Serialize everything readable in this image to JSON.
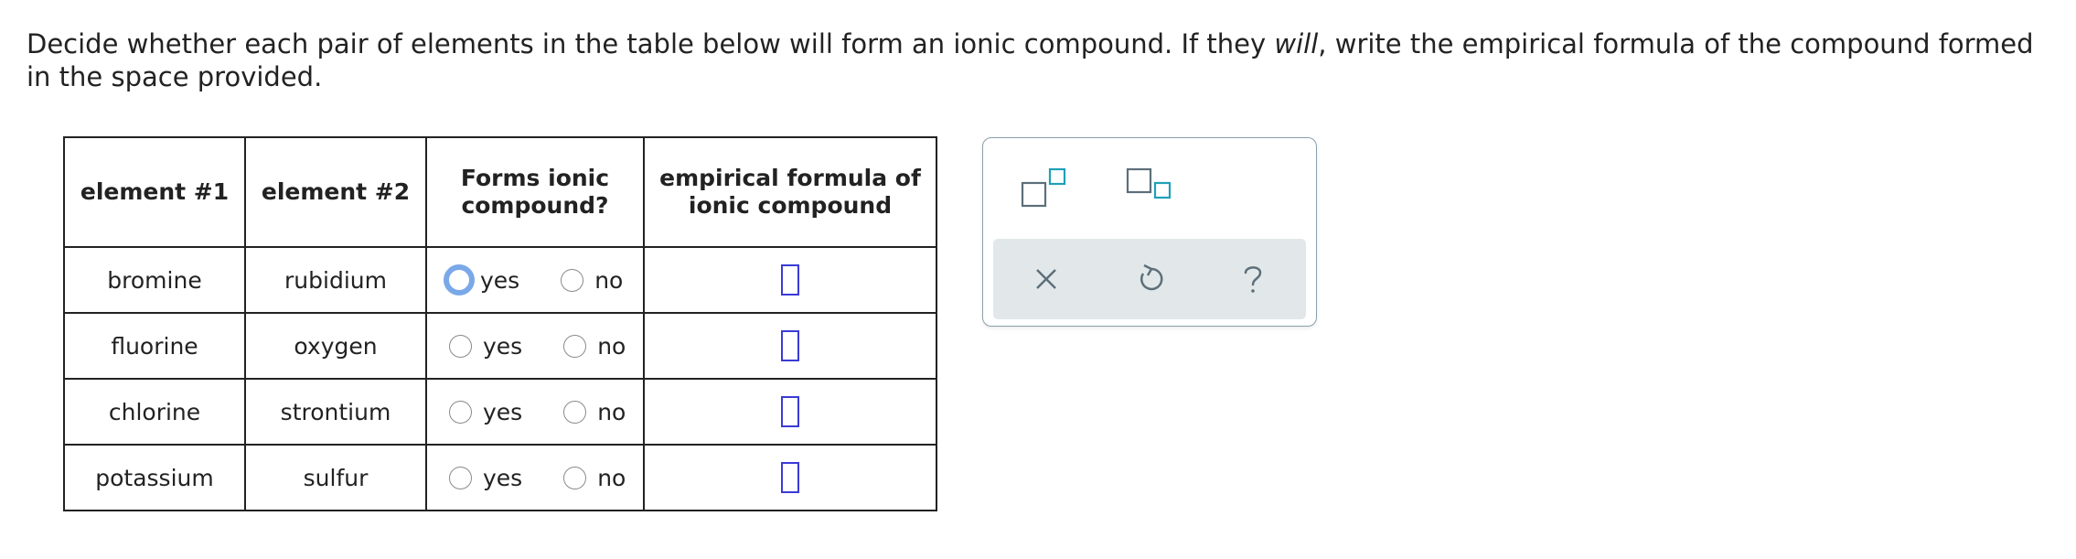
{
  "question": {
    "text_before": "Decide whether each pair of elements in the table below will form an ionic compound. If they ",
    "emphasis": "will",
    "text_after": ", write the empirical formula of the compound formed in the space provided."
  },
  "table": {
    "headers": {
      "element1": "element #1",
      "element2": "element #2",
      "forms_ionic_line1": "Forms ionic",
      "forms_ionic_line2": "compound?",
      "formula_line1": "empirical formula of",
      "formula_line2": "ionic compound"
    },
    "rows": [
      {
        "element1": "bromine",
        "element2": "rubidium",
        "yes": "yes",
        "no": "no"
      },
      {
        "element1": "fluorine",
        "element2": "oxygen",
        "yes": "yes",
        "no": "no"
      },
      {
        "element1": "chlorine",
        "element2": "strontium",
        "yes": "yes",
        "no": "no"
      },
      {
        "element1": "potassium",
        "element2": "sulfur",
        "yes": "yes",
        "no": "no"
      }
    ]
  },
  "toolbox": {
    "tools": [
      "superscript-icon",
      "subscript-icon"
    ],
    "actions": [
      "clear-icon",
      "undo-icon",
      "help-icon"
    ],
    "colors": {
      "icon_gray": "#5d6f7a",
      "icon_teal": "#1fa0b8",
      "action_bar": "#e2e8ea",
      "border": "#8aa0ac"
    }
  },
  "colors": {
    "answer_box": "#3a3ad6",
    "radio_focus": "#7aa8e8",
    "text": "#222222"
  }
}
